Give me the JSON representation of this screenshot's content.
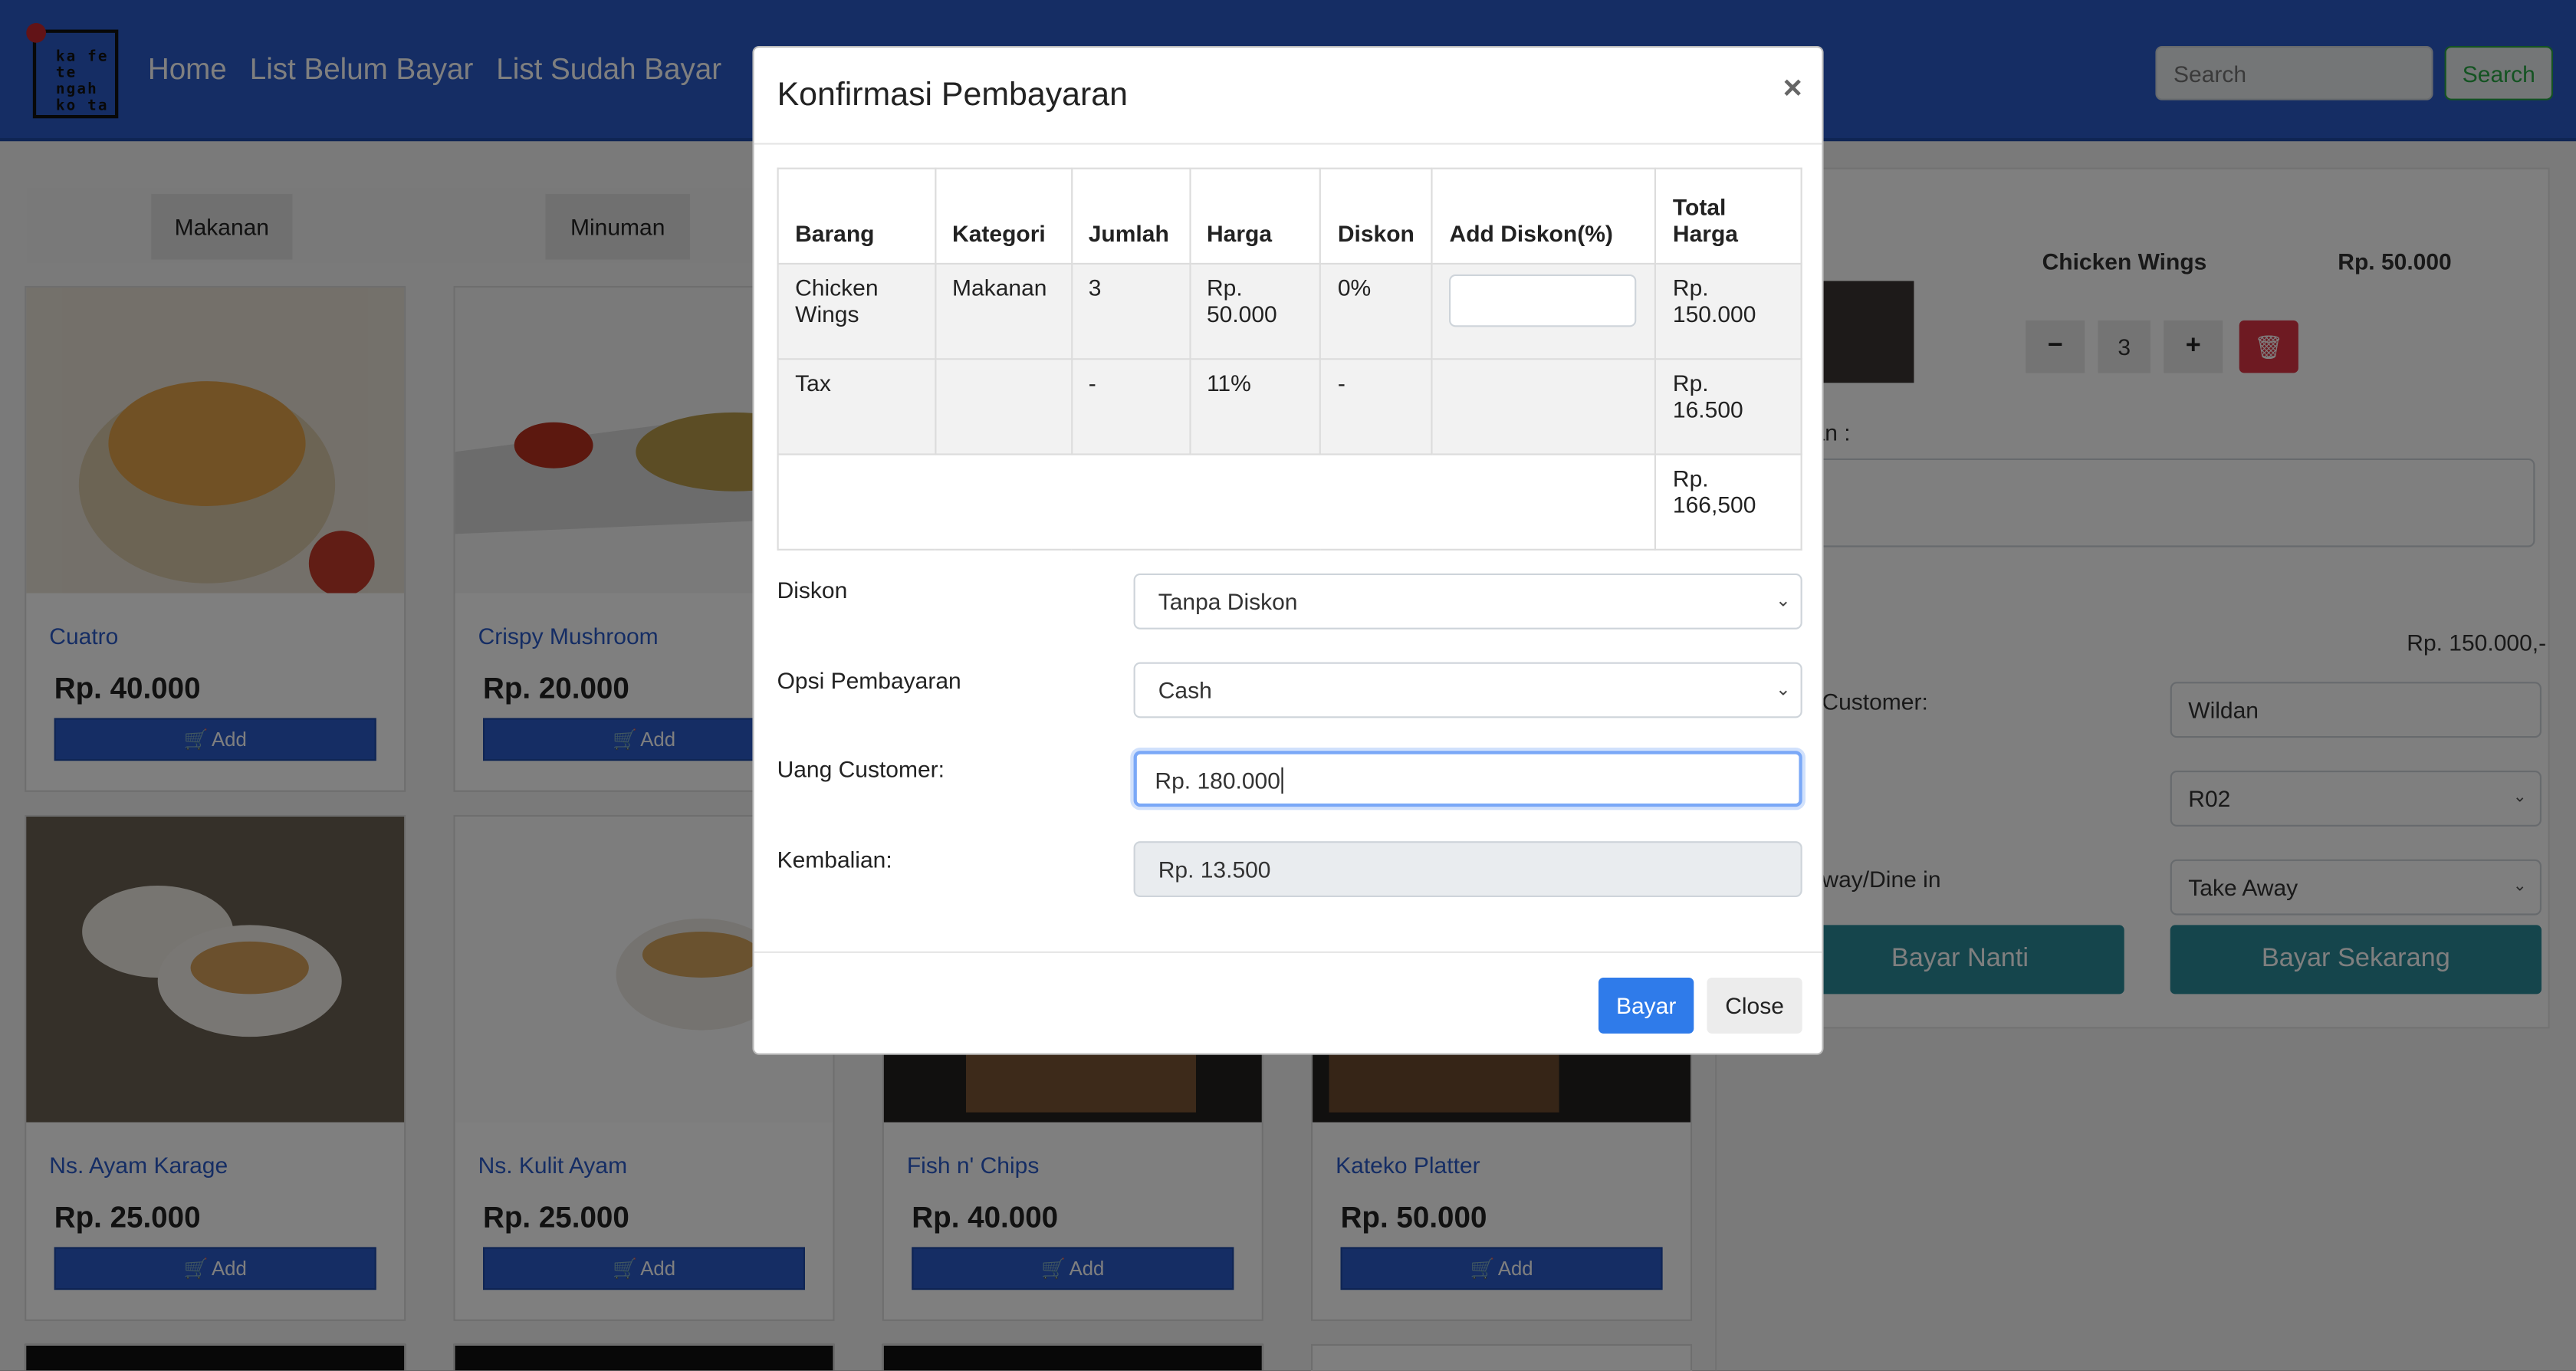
{
  "navbar": {
    "logo_text": [
      "ka fe",
      "te ngah",
      "ko ta"
    ],
    "links": [
      "Home",
      "List Belum Bayar",
      "List Sudah Bayar"
    ],
    "search_placeholder": "Search",
    "search_button": "Search"
  },
  "categories": [
    "Makanan",
    "Minuman"
  ],
  "add_label": "Add",
  "menu": [
    {
      "name": "Cuatro",
      "price": "Rp. 40.000"
    },
    {
      "name": "Crispy Mushroom",
      "price": "Rp. 20.000"
    },
    {
      "name": "Ns. Ayam Karage",
      "price": "Rp. 25.000"
    },
    {
      "name": "Ns. Kulit Ayam",
      "price": "Rp. 25.000"
    },
    {
      "name": "Fish n' Chips",
      "price": "Rp. 40.000"
    },
    {
      "name": "Kateko Platter",
      "price": "Rp. 50.000"
    }
  ],
  "cart": {
    "item_name": "Chicken Wings",
    "item_price": "Rp. 50.000",
    "qty": "3",
    "notes_label": "an :",
    "total": "Rp. 150.000,-",
    "customer_label": "Customer:",
    "customer_value": "Wildan",
    "table_value": "R02",
    "order_type_label": "way/Dine in",
    "order_type_value": "Take Away",
    "pay_later": "Bayar Nanti",
    "pay_now": "Bayar Sekarang"
  },
  "modal": {
    "title": "Konfirmasi Pembayaran",
    "close_glyph": "×",
    "headers": [
      "Barang",
      "Kategori",
      "Jumlah",
      "Harga",
      "Diskon",
      "Add Diskon(%)",
      "Total Harga"
    ],
    "rows": [
      [
        "Chicken Wings",
        "Makanan",
        "3",
        "Rp. 50.000",
        "0%",
        "",
        "Rp. 150.000"
      ],
      [
        "Tax",
        "",
        "-",
        "11%",
        "-",
        "",
        "Rp. 16.500"
      ],
      [
        "",
        "",
        "",
        "",
        "",
        "",
        "Rp. 166,500"
      ]
    ],
    "diskon_label": "Diskon",
    "diskon_value": "Tanpa Diskon",
    "opsi_label": "Opsi Pembayaran",
    "opsi_value": "Cash",
    "uang_label": "Uang Customer:",
    "uang_value": "Rp. 180.000",
    "kembalian_label": "Kembalian:",
    "kembalian_value": "Rp. 13.500",
    "btn_bayar": "Bayar",
    "btn_close": "Close"
  }
}
